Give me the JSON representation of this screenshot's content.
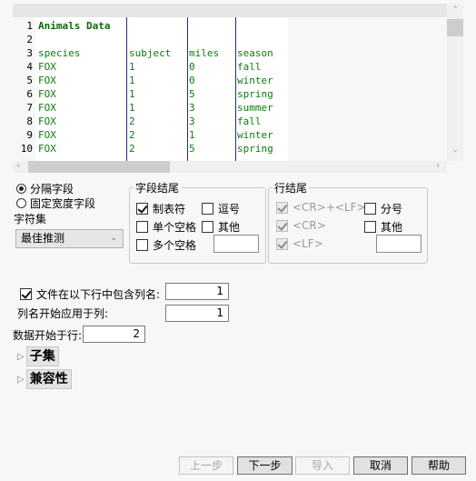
{
  "preview": {
    "line_numbers": [
      "1",
      "2",
      "3",
      "4",
      "5",
      "6",
      "7",
      "8",
      "9",
      "10"
    ],
    "title": "Animals Data",
    "headers": [
      "species",
      "subject",
      "miles",
      "season"
    ],
    "rows": [
      [
        "FOX",
        "1",
        "0",
        "fall"
      ],
      [
        "FOX",
        "1",
        "0",
        "winter"
      ],
      [
        "FOX",
        "1",
        "5",
        "spring"
      ],
      [
        "FOX",
        "1",
        "3",
        "summer"
      ],
      [
        "FOX",
        "2",
        "3",
        "fall"
      ],
      [
        "FOX",
        "2",
        "1",
        "winter"
      ],
      [
        "FOX",
        "2",
        "5",
        "spring"
      ]
    ],
    "text_color": "#0f7a0f",
    "column_line_color": "#2b2b8c"
  },
  "field_type": {
    "options": [
      {
        "label": "分隔字段",
        "selected": true
      },
      {
        "label": "固定宽度字段",
        "selected": false
      }
    ]
  },
  "charset": {
    "label": "字符集",
    "selected": "最佳推测"
  },
  "field_end": {
    "legend": "字段结尾",
    "tab": {
      "label": "制表符",
      "checked": true
    },
    "comma": {
      "label": "逗号",
      "checked": false
    },
    "single_space": {
      "label": "单个空格",
      "checked": false
    },
    "other": {
      "label": "其他",
      "checked": false,
      "value": ""
    },
    "multi_space": {
      "label": "多个空格",
      "checked": false
    }
  },
  "line_end": {
    "legend": "行结尾",
    "crlf": {
      "label": "<CR>+<LF>",
      "checked": true,
      "disabled": true
    },
    "cr": {
      "label": "<CR>",
      "checked": true,
      "disabled": true
    },
    "lf": {
      "label": "<LF>",
      "checked": true,
      "disabled": true
    },
    "semicolon": {
      "label": "分号",
      "checked": false
    },
    "other": {
      "label": "其他",
      "checked": false,
      "value": ""
    }
  },
  "header_options": {
    "has_column_names": {
      "label": "文件在以下行中包含列名:",
      "checked": true,
      "value": "1"
    },
    "names_start_col": {
      "label": "列名开始应用于列:",
      "value": "1"
    },
    "data_start_row": {
      "label": "数据开始于行:",
      "value": "2"
    }
  },
  "sections": {
    "subset": "子集",
    "compat": "兼容性"
  },
  "footer": {
    "back": "上一步",
    "next": "下一步",
    "import": "导入",
    "cancel": "取消",
    "help": "帮助"
  }
}
